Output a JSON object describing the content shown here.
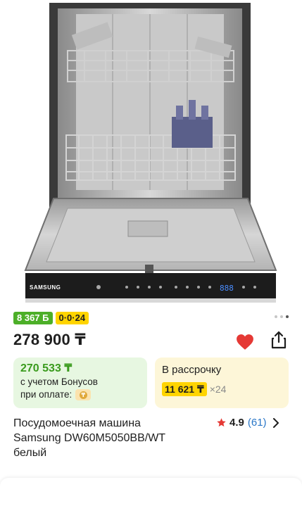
{
  "product": {
    "image_alt": "Samsung",
    "control_brand": "SAMSUNG",
    "display_digits": "888"
  },
  "badges": {
    "bonus_label": "8 367 Б",
    "installment_label": "0·0·24"
  },
  "price": {
    "value": "278 900 ₸"
  },
  "bonus_card": {
    "price": "270 533 ₸",
    "line1": "с учетом Бонусов",
    "line2": "при оплате:"
  },
  "installment_card": {
    "label": "В рассрочку",
    "amount": "11 621 ₸",
    "months": "×24"
  },
  "title": {
    "line1": "Посудомоечная машина",
    "line2": "Samsung DW60M5050BB/WT",
    "line3": "белый"
  },
  "rating": {
    "value": "4.9",
    "count": "(61)"
  },
  "carousel": {
    "total": 3,
    "active_index": 2
  },
  "colors": {
    "accent_green": "#4caf28",
    "accent_yellow": "#ffd400",
    "favorite_red": "#e53935",
    "link_blue": "#2a77c8"
  }
}
